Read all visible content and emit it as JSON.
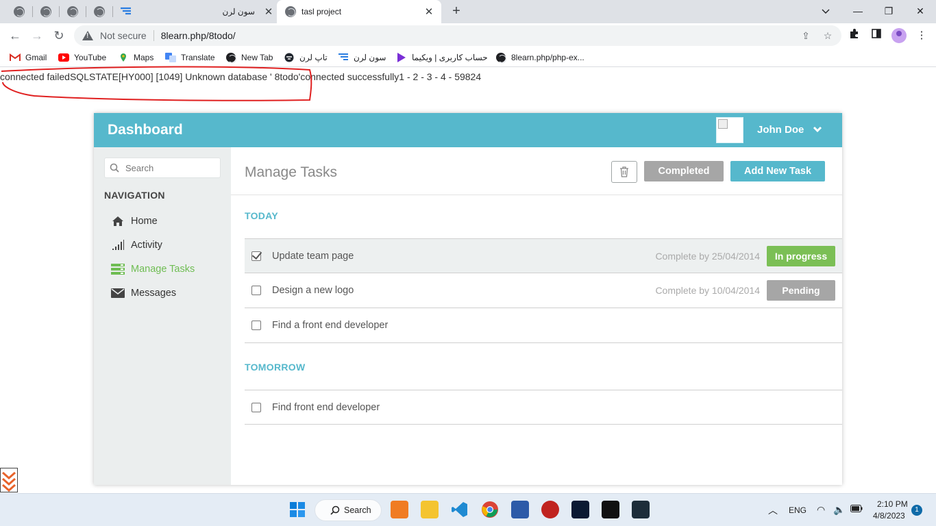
{
  "browser": {
    "tabs": [
      {
        "title": "سون لرن"
      },
      {
        "title": "tasl project"
      }
    ],
    "address": {
      "security_label": "Not secure",
      "url": "8learn.php/8todo/"
    },
    "bookmarks": [
      {
        "label": "Gmail",
        "icon": "gmail-icon"
      },
      {
        "label": "YouTube",
        "icon": "youtube-icon"
      },
      {
        "label": "Maps",
        "icon": "maps-icon"
      },
      {
        "label": "Translate",
        "icon": "translate-icon"
      },
      {
        "label": "New Tab",
        "icon": "globe-icon"
      },
      {
        "label": "تاپ لرن",
        "icon": "toplearn-icon"
      },
      {
        "label": "سون لرن",
        "icon": "sevenlearn-icon"
      },
      {
        "label": "حساب کاربری | ویکیما",
        "icon": "wikima-icon"
      },
      {
        "label": "8learn.php/php-ex...",
        "icon": "globe-icon"
      }
    ]
  },
  "page": {
    "php_output": "connected failedSQLSTATE[HY000] [1049] Unknown database ' 8todo'connected successfully1 - 2 - 3 - 4 - 59824"
  },
  "app": {
    "brand": "Dashboard",
    "user": {
      "name": "John Doe"
    },
    "sidebar": {
      "search_placeholder": "Search",
      "nav_title": "NAVIGATION",
      "items": [
        {
          "label": "Home",
          "icon": "home-icon",
          "active": false
        },
        {
          "label": "Activity",
          "icon": "signal-bars-icon",
          "active": false
        },
        {
          "label": "Manage Tasks",
          "icon": "tasks-icon",
          "active": true
        },
        {
          "label": "Messages",
          "icon": "envelope-icon",
          "active": false
        }
      ]
    },
    "main": {
      "title": "Manage Tasks",
      "completed_label": "Completed",
      "add_label": "Add New Task",
      "sections": [
        {
          "label": "TODAY",
          "tasks": [
            {
              "name": "Update team page",
              "checked": true,
              "due": "Complete by 25/04/2014",
              "status": "In progress",
              "status_color": "#7bbf55"
            },
            {
              "name": "Design a new logo",
              "checked": false,
              "due": "Complete by 10/04/2014",
              "status": "Pending",
              "status_color": "#a6a6a6"
            },
            {
              "name": "Find a front end developer",
              "checked": false,
              "due": "",
              "status": "",
              "status_color": ""
            }
          ]
        },
        {
          "label": "TOMORROW",
          "tasks": [
            {
              "name": "Find front end developer",
              "checked": false,
              "due": "",
              "status": "",
              "status_color": ""
            }
          ]
        }
      ]
    }
  },
  "taskbar": {
    "search_label": "Search",
    "language": "ENG",
    "time": "2:10 PM",
    "date": "4/8/2023",
    "notification_count": "1"
  }
}
